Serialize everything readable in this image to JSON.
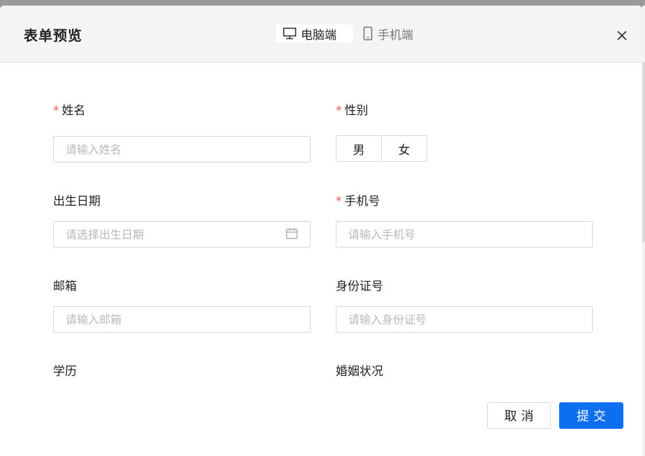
{
  "dialog": {
    "title": "表单预览",
    "device_tabs": [
      {
        "label": "电脑端",
        "icon": "desktop-icon",
        "active": true
      },
      {
        "label": "手机端",
        "icon": "mobile-icon",
        "active": false
      }
    ],
    "close_icon": "close-icon"
  },
  "form": {
    "name": {
      "label": "姓名",
      "required": true,
      "placeholder": "请输入姓名"
    },
    "gender": {
      "label": "性别",
      "required": true,
      "options": [
        "男",
        "女"
      ]
    },
    "birthdate": {
      "label": "出生日期",
      "required": false,
      "placeholder": "请选择出生日期",
      "icon": "calendar-icon"
    },
    "phone": {
      "label": "手机号",
      "required": true,
      "placeholder": "请输入手机号"
    },
    "email": {
      "label": "邮箱",
      "required": false,
      "placeholder": "请输入邮箱"
    },
    "id_number": {
      "label": "身份证号",
      "required": false,
      "placeholder": "请输入身份证号"
    },
    "education": {
      "label": "学历"
    },
    "marital_status": {
      "label": "婚姻状况"
    },
    "required_mark": "*"
  },
  "footer": {
    "cancel_label": "取消",
    "submit_label": "提交"
  },
  "colors": {
    "primary": "#0b6ff0",
    "required": "#e25656",
    "header_bg": "#f4f4f5"
  }
}
